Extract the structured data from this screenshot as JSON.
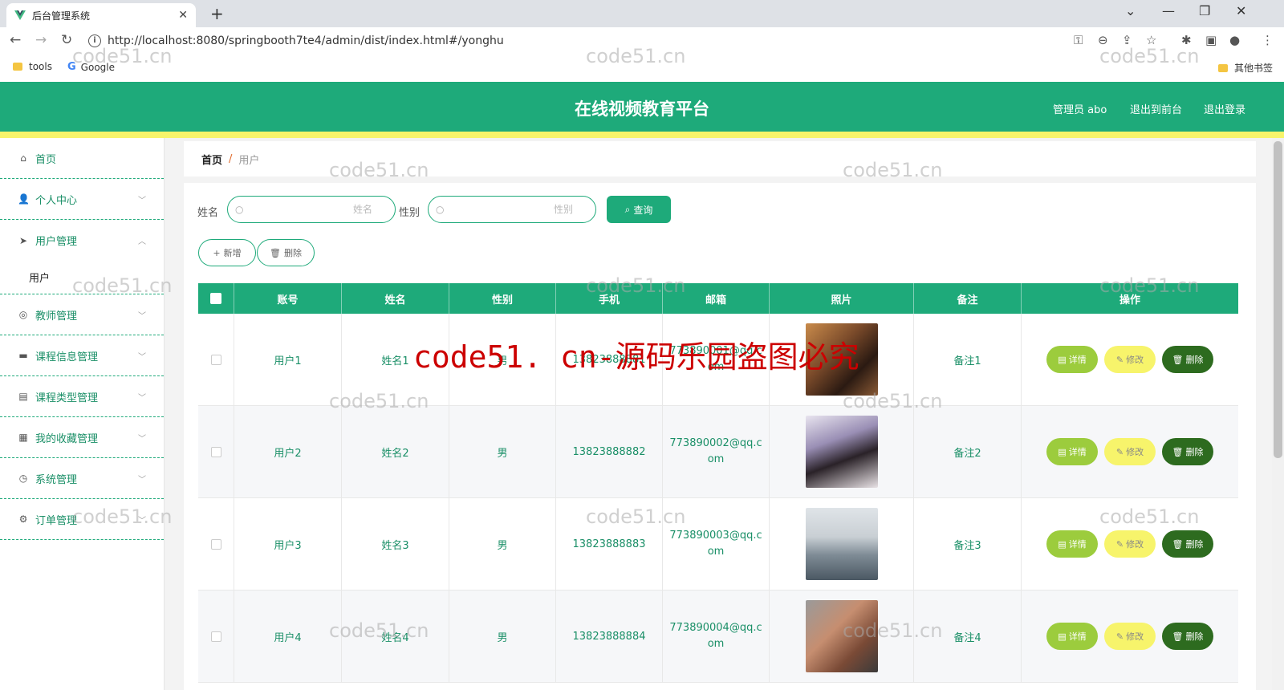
{
  "browser": {
    "tab_title": "后台管理系统",
    "url": "http://localhost:8080/springbooth7te4/admin/dist/index.html#/yonghu",
    "bookmarks": [
      "tools",
      "Google"
    ],
    "other_bookmarks": "其他书签"
  },
  "header": {
    "title": "在线视频教育平台",
    "admin_label": "管理员 abo",
    "front_link": "退出到前台",
    "logout_link": "退出登录",
    "accent": "#1eaa7a"
  },
  "sidebar": {
    "items": [
      {
        "label": "首页",
        "icon": "home-icon"
      },
      {
        "label": "个人中心",
        "icon": "user-icon"
      },
      {
        "label": "用户管理",
        "icon": "send-icon"
      },
      {
        "label": "教师管理",
        "icon": "circle-icon"
      },
      {
        "label": "课程信息管理",
        "icon": "monitor-icon"
      },
      {
        "label": "课程类型管理",
        "icon": "clipboard-icon"
      },
      {
        "label": "我的收藏管理",
        "icon": "document-icon"
      },
      {
        "label": "系统管理",
        "icon": "clock-icon"
      },
      {
        "label": "订单管理",
        "icon": "settings-icon"
      }
    ],
    "sub_item": "用户"
  },
  "breadcrumb": {
    "home": "首页",
    "sep": "/",
    "current": "用户"
  },
  "filters": {
    "name_label": "姓名",
    "name_placeholder": "姓名",
    "gender_label": "性别",
    "gender_placeholder": "性别",
    "query_button": "查询"
  },
  "actions": {
    "add": "新增",
    "delete": "删除"
  },
  "table": {
    "columns": [
      "账号",
      "姓名",
      "性别",
      "手机",
      "邮箱",
      "照片",
      "备注",
      "操作"
    ],
    "rows": [
      {
        "account": "用户1",
        "name": "姓名1",
        "gender": "男",
        "phone": "13823888881",
        "email": "773890001@qq.com",
        "remark": "备注1"
      },
      {
        "account": "用户2",
        "name": "姓名2",
        "gender": "男",
        "phone": "13823888882",
        "email": "773890002@qq.com",
        "remark": "备注2"
      },
      {
        "account": "用户3",
        "name": "姓名3",
        "gender": "男",
        "phone": "13823888883",
        "email": "773890003@qq.com",
        "remark": "备注3"
      },
      {
        "account": "用户4",
        "name": "姓名4",
        "gender": "男",
        "phone": "13823888884",
        "email": "773890004@qq.com",
        "remark": "备注4"
      }
    ],
    "row_buttons": {
      "detail": "详情",
      "edit": "修改",
      "delete": "删除"
    }
  },
  "watermark": {
    "small": "code51.cn",
    "big": "code51. cn-源码乐园盗图必究"
  }
}
